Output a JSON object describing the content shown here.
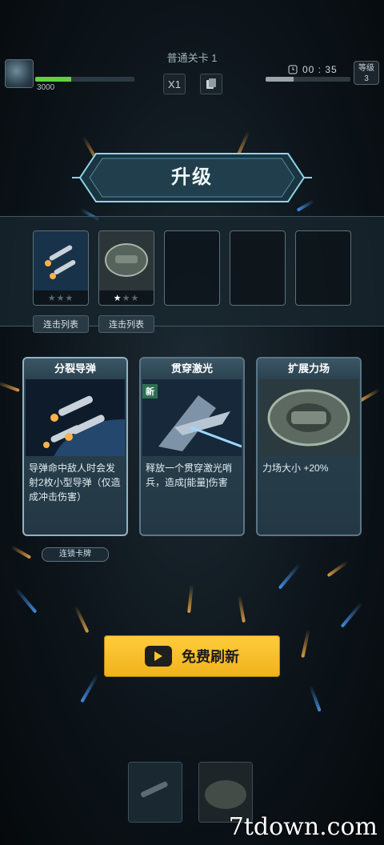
{
  "hud": {
    "stage_title": "普通关卡 1",
    "player_score": "3000",
    "health_fraction": 0.36,
    "speed_label": "X1",
    "timer": "00 : 35",
    "timer_fraction": 0.33,
    "level_label": "等级",
    "level_value": "3"
  },
  "upgrade": {
    "title": "升级",
    "slots": [
      {
        "filled": true,
        "stars": 0,
        "max_stars": 3,
        "art": "missile-art"
      },
      {
        "filled": true,
        "stars": 1,
        "max_stars": 3,
        "art": "shield-art"
      },
      {
        "filled": false
      },
      {
        "filled": false
      },
      {
        "filled": false
      }
    ],
    "slot_tags": [
      "连击列表",
      "连击列表"
    ]
  },
  "cards": [
    {
      "title": "分裂导弹",
      "desc": "导弹命中敌人时会发射2枚小型导弹（仅造成冲击伤害）",
      "badge": "",
      "art": "missile-art",
      "selected": true
    },
    {
      "title": "贯穿激光",
      "desc": "释放一个贯穿激光哨兵，造成[能量]伤害",
      "badge": "新",
      "art": "laser-art",
      "selected": false
    },
    {
      "title": "扩展力场",
      "desc": "力场大小 +20%",
      "badge": "",
      "art": "shield-art",
      "selected": false
    }
  ],
  "chain_card_label": "连锁卡牌",
  "refresh_button": {
    "label": "免费刷新",
    "icon": "video-camera-icon"
  },
  "watermark": {
    "site": "7tdown.com"
  },
  "colors": {
    "accent_yellow": "#f5c531",
    "health_green": "#62d13c",
    "panel_teal": "#2a4350"
  }
}
